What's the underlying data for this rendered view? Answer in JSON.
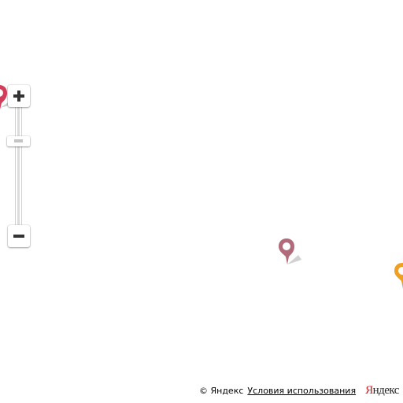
{
  "map": {
    "placemarks": [
      {
        "name": "placemark-left-edge",
        "color": "#d23d5a"
      },
      {
        "name": "placemark-center",
        "color": "#b06a7a"
      },
      {
        "name": "placemark-right-edge",
        "color": "#f0a020"
      }
    ]
  },
  "zoom_control": {
    "zoom_in_icon": "plus-icon",
    "zoom_out_icon": "minus-icon"
  },
  "copyrights": {
    "copyright_text": "© Яндекс",
    "terms_link": "Условия использования",
    "logo_first_letter": "Я",
    "logo_rest": "ндекс"
  }
}
